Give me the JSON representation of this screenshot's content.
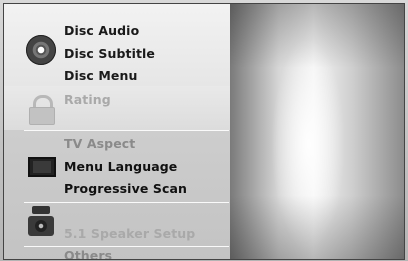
{
  "menu": {
    "disc": {
      "items": [
        "Disc Audio",
        "Disc Subtitle",
        "Disc Menu"
      ]
    },
    "lock": {
      "items": [
        "Rating"
      ]
    },
    "display": {
      "items": [
        "TV Aspect",
        "Menu Language",
        "Progressive Scan"
      ]
    },
    "audio": {
      "items": [
        "5.1 Speaker Setup"
      ]
    },
    "others": {
      "items": [
        "Others"
      ]
    }
  },
  "icons": {
    "disc": "disc-icon",
    "lock": "lock-icon",
    "display": "tv-icon",
    "audio": "speaker-icon"
  }
}
